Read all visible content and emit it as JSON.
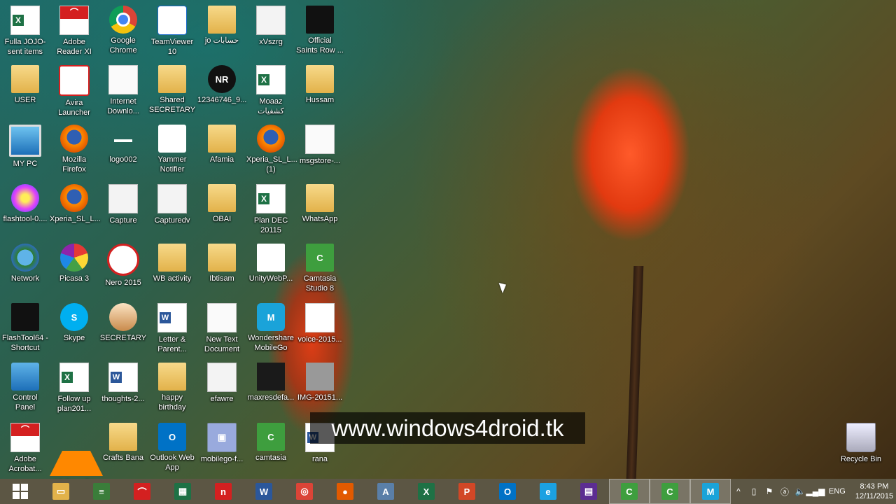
{
  "desktop": {
    "icons": [
      {
        "name": "fulla-jojo-sent-items-icon",
        "label": "Fulla JOJO-\nsent items",
        "glyph": "g-excel"
      },
      {
        "name": "adobe-reader-xi-icon",
        "label": "Adobe\nReader XI",
        "glyph": "g-pdf"
      },
      {
        "name": "google-chrome-icon",
        "label": "Google\nChrome",
        "glyph": "g-round g-chrome"
      },
      {
        "name": "teamviewer-icon",
        "label": "TeamViewer\n10",
        "glyph": "g-teamviewer",
        "text": "⇄"
      },
      {
        "name": "jo-folder-icon",
        "label": "jo حسابات",
        "glyph": "g-folder"
      },
      {
        "name": "xvszrg-icon",
        "label": "xVszrg",
        "glyph": "g-thumb"
      },
      {
        "name": "official-saints-row-icon",
        "label": "Official\nSaints Row ...",
        "glyph": "g-dark"
      },
      {
        "name": "user-folder-icon",
        "label": "USER",
        "glyph": "g-folder"
      },
      {
        "name": "avira-launcher-icon",
        "label": "Avira\nLauncher",
        "glyph": "g-avira",
        "text": "✓"
      },
      {
        "name": "internet-download-icon",
        "label": "Internet\nDownlo...",
        "glyph": "g-doc"
      },
      {
        "name": "shared-secretary-icon",
        "label": "Shared\nSECRETARY",
        "glyph": "g-folder"
      },
      {
        "name": "image-12346746-icon",
        "label": "12346746_9...",
        "glyph": "g-dark g-round",
        "text": "NR"
      },
      {
        "name": "moaaz-excel-icon",
        "label": "Moaaz\nكشفيات",
        "glyph": "g-excel"
      },
      {
        "name": "hussam-folder-icon",
        "label": "Hussam",
        "glyph": "g-folder"
      },
      {
        "name": "my-pc-icon",
        "label": "MY PC",
        "glyph": "g-monitor"
      },
      {
        "name": "mozilla-firefox-icon",
        "label": "Mozilla\nFirefox",
        "glyph": "g-round g-firefox"
      },
      {
        "name": "logo002-icon",
        "label": "logo002",
        "glyph": "g-logo",
        "text": "▬▬"
      },
      {
        "name": "yammer-notifier-icon",
        "label": "Yammer\nNotifier",
        "glyph": "g-yammer",
        "text": "y"
      },
      {
        "name": "afamia-folder-icon",
        "label": "Afamia",
        "glyph": "g-folder"
      },
      {
        "name": "xperia-sl-1-icon",
        "label": "Xperia_SL_L...\n(1)",
        "glyph": "g-round g-firefox"
      },
      {
        "name": "msgstore-icon",
        "label": "msgstore-...",
        "glyph": "g-doc"
      },
      {
        "name": "flashtool-icon",
        "label": "flashtool-0....",
        "glyph": "g-flashtool"
      },
      {
        "name": "xperia-sl-icon",
        "label": "Xperia_SL_L...",
        "glyph": "g-round g-firefox"
      },
      {
        "name": "capture-icon",
        "label": "Capture",
        "glyph": "g-thumb"
      },
      {
        "name": "capturedv-icon",
        "label": "Capturedv",
        "glyph": "g-thumb"
      },
      {
        "name": "obai-folder-icon",
        "label": "OBAI",
        "glyph": "g-folder"
      },
      {
        "name": "plan-dec-icon",
        "label": "Plan DEC\n20115",
        "glyph": "g-excel"
      },
      {
        "name": "whatsapp-folder-icon",
        "label": "WhatsApp",
        "glyph": "g-folder"
      },
      {
        "name": "network-icon",
        "label": "Network",
        "glyph": "g-globe"
      },
      {
        "name": "picasa-icon",
        "label": "Picasa 3",
        "glyph": "g-picasa"
      },
      {
        "name": "nero-2015-icon",
        "label": "Nero 2015",
        "glyph": "g-nero",
        "text": "nero"
      },
      {
        "name": "wb-activity-folder-icon",
        "label": "WB activity",
        "glyph": "g-folder"
      },
      {
        "name": "ibtisam-folder-icon",
        "label": "Ibtisam",
        "glyph": "g-folder"
      },
      {
        "name": "unity-webplayer-icon",
        "label": "UnityWebP...",
        "glyph": "g-unity",
        "text": "◆"
      },
      {
        "name": "camtasia-studio-icon",
        "label": "Camtasia\nStudio 8",
        "glyph": "g-camtasia",
        "text": "C"
      },
      {
        "name": "flashtool64-shortcut-icon",
        "label": "FlashTool64 -\nShortcut",
        "glyph": "g-dark",
        "text": ""
      },
      {
        "name": "skype-icon",
        "label": "Skype",
        "glyph": "g-skype",
        "text": "S"
      },
      {
        "name": "secretary-icon",
        "label": "SECRETARY",
        "glyph": "g-users"
      },
      {
        "name": "letter-parent-icon",
        "label": "Letter &\nParent...",
        "glyph": "g-word"
      },
      {
        "name": "new-text-document-icon",
        "label": "New Text\nDocument",
        "glyph": "g-doc"
      },
      {
        "name": "wondershare-mobilego-icon",
        "label": "Wondershare\nMobileGo",
        "glyph": "g-mobilego",
        "text": "M"
      },
      {
        "name": "voice-2015-icon",
        "label": "voice-2015...",
        "glyph": "g-mp3",
        "text": "♪"
      },
      {
        "name": "control-panel-icon",
        "label": "Control\nPanel",
        "glyph": "g-control"
      },
      {
        "name": "follow-up-plan-icon",
        "label": "Follow up\nplan201...",
        "glyph": "g-excel"
      },
      {
        "name": "thoughts-icon",
        "label": "thoughts-2...",
        "glyph": "g-word"
      },
      {
        "name": "happy-birthday-folder-icon",
        "label": "happy\nbirthday",
        "glyph": "g-folder"
      },
      {
        "name": "efawre-icon",
        "label": "efawre",
        "glyph": "g-thumb"
      },
      {
        "name": "maxresdefault-icon",
        "label": "maxresdefa...",
        "glyph": "g-photo"
      },
      {
        "name": "img-20151-icon",
        "label": "IMG-20151...",
        "glyph": "g-img"
      },
      {
        "name": "adobe-acrobat-icon",
        "label": "Adobe\nAcrobat...",
        "glyph": "g-pdf"
      },
      {
        "name": "vlc-media-player-icon",
        "label": "VLC media\nplayer",
        "glyph": "g-vlc"
      },
      {
        "name": "crafts-bana-folder-icon",
        "label": "Crafts Bana",
        "glyph": "g-folder"
      },
      {
        "name": "outlook-web-app-icon",
        "label": "Outlook Web\nApp",
        "glyph": "g-outlook",
        "text": "O"
      },
      {
        "name": "mobilego-file-icon",
        "label": "mobilego-f...",
        "glyph": "g-mobilego-f",
        "text": "▣"
      },
      {
        "name": "camtasia-icon",
        "label": "camtasia",
        "glyph": "g-camtasia",
        "text": "C"
      },
      {
        "name": "rana-icon",
        "label": "rana",
        "glyph": "g-word"
      }
    ],
    "recycle_bin": {
      "label": "Recycle Bin"
    },
    "watermark": "www.windows4droid.tk"
  },
  "taskbar": {
    "apps": [
      {
        "name": "start-button",
        "icon": "windows-logo-icon",
        "active": false
      },
      {
        "name": "taskbar-file-explorer",
        "icon": "folder-icon",
        "color": "#e2b24a",
        "text": "▭",
        "active": false
      },
      {
        "name": "taskbar-books",
        "icon": "books-icon",
        "color": "#3a7d3a",
        "text": "≡",
        "active": false
      },
      {
        "name": "taskbar-adobe-reader",
        "icon": "pdf-icon",
        "color": "#d42020",
        "text": "⌒",
        "active": false
      },
      {
        "name": "taskbar-excel-sheet",
        "icon": "spreadsheet-icon",
        "color": "#1e7145",
        "text": "▦",
        "active": false
      },
      {
        "name": "taskbar-nero",
        "icon": "nero-icon",
        "color": "#d42020",
        "text": "n",
        "active": false
      },
      {
        "name": "taskbar-word",
        "icon": "word-icon",
        "color": "#2b579a",
        "text": "W",
        "active": false
      },
      {
        "name": "taskbar-chrome",
        "icon": "chrome-icon",
        "color": "#db4437",
        "text": "◎",
        "active": false
      },
      {
        "name": "taskbar-firefox",
        "icon": "firefox-icon",
        "color": "#e25a00",
        "text": "●",
        "active": false
      },
      {
        "name": "taskbar-font-tool",
        "icon": "font-icon",
        "color": "#5a7fa8",
        "text": "A",
        "active": false
      },
      {
        "name": "taskbar-excel",
        "icon": "excel-icon",
        "color": "#1e7145",
        "text": "X",
        "active": false
      },
      {
        "name": "taskbar-powerpoint",
        "icon": "powerpoint-icon",
        "color": "#d24726",
        "text": "P",
        "active": false
      },
      {
        "name": "taskbar-outlook",
        "icon": "outlook-icon",
        "color": "#0072c6",
        "text": "O",
        "active": false
      },
      {
        "name": "taskbar-internet-explorer",
        "icon": "internet-explorer-icon",
        "color": "#1ba1e2",
        "text": "e",
        "active": false
      },
      {
        "name": "taskbar-calendar",
        "icon": "calendar-icon",
        "color": "#5c2d91",
        "text": "▤",
        "active": false
      },
      {
        "name": "taskbar-camtasia-studio",
        "icon": "camtasia-icon",
        "color": "#3e9e3e",
        "text": "C",
        "active": true
      },
      {
        "name": "taskbar-camtasia-recorder",
        "icon": "camtasia-recorder-icon",
        "color": "#3e9e3e",
        "text": "C",
        "active": true
      },
      {
        "name": "taskbar-mobilego",
        "icon": "mobilego-icon",
        "color": "#1aa3d9",
        "text": "M",
        "active": true
      }
    ],
    "tray": {
      "icons": [
        {
          "name": "tray-overflow-chevron-icon",
          "text": "^"
        },
        {
          "name": "tray-device-icon",
          "text": "▯"
        },
        {
          "name": "tray-flag-icon",
          "text": "⚑"
        },
        {
          "name": "tray-avira-icon",
          "text": "ⓐ"
        },
        {
          "name": "tray-volume-icon",
          "text": "🔈"
        },
        {
          "name": "tray-signal-icon",
          "text": "▂▄▆"
        }
      ],
      "language": "ENG",
      "time": "8:43 PM",
      "date": "12/11/2015"
    }
  }
}
